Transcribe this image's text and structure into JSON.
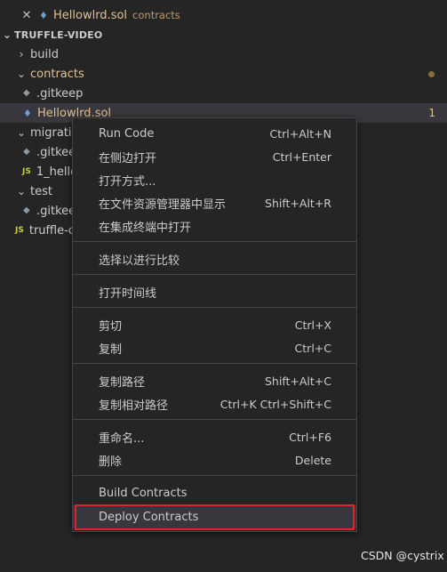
{
  "open_editor": {
    "close_glyph": "✕",
    "file_name": "Hellowlrd.sol",
    "folder": "contracts"
  },
  "explorer": {
    "section_title": "TRUFFLE-VIDEO",
    "items": [
      {
        "label": "build",
        "chevron": "›"
      },
      {
        "label": "contracts",
        "chevron": "⌄"
      },
      {
        "label": ".gitkeep"
      },
      {
        "label": "Hellowlrd.sol",
        "badge": "1"
      },
      {
        "label": "migratic",
        "chevron": "⌄"
      },
      {
        "label": ".gitkee"
      },
      {
        "label": "1_hello",
        "js_tag": "JS"
      },
      {
        "label": "test",
        "chevron": "⌄"
      },
      {
        "label": ".gitkee"
      },
      {
        "label": "truffle-c",
        "js_tag": "JS"
      }
    ],
    "contracts_badge": "1"
  },
  "context_menu": {
    "items": [
      {
        "label": "Run Code",
        "shortcut": "Ctrl+Alt+N"
      },
      {
        "label": "在侧边打开",
        "shortcut": "Ctrl+Enter"
      },
      {
        "label": "打开方式...",
        "shortcut": ""
      },
      {
        "label": "在文件资源管理器中显示",
        "shortcut": "Shift+Alt+R"
      },
      {
        "label": "在集成终端中打开",
        "shortcut": ""
      },
      {
        "label": "选择以进行比较",
        "shortcut": ""
      },
      {
        "label": "打开时间线",
        "shortcut": ""
      },
      {
        "label": "剪切",
        "shortcut": "Ctrl+X"
      },
      {
        "label": "复制",
        "shortcut": "Ctrl+C"
      },
      {
        "label": "复制路径",
        "shortcut": "Shift+Alt+C"
      },
      {
        "label": "复制相对路径",
        "shortcut": "Ctrl+K Ctrl+Shift+C"
      },
      {
        "label": "重命名...",
        "shortcut": "Ctrl+F6"
      },
      {
        "label": "删除",
        "shortcut": "Delete"
      },
      {
        "label": "Build Contracts",
        "shortcut": ""
      },
      {
        "label": "Deploy Contracts",
        "shortcut": ""
      }
    ],
    "highlighted": "Deploy Contracts"
  },
  "watermark": "CSDN @cystrix",
  "colors": {
    "background": "#252526",
    "modified": "#e2c08d",
    "highlight_border": "#e0242a"
  }
}
